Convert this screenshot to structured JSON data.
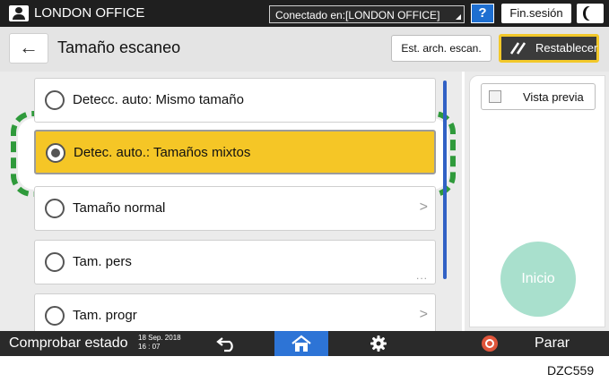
{
  "topbar": {
    "office_name": "LONDON OFFICE",
    "connection": "Conectado en:[LONDON OFFICE]",
    "help_label": "?",
    "logout_label": "Fin.sesión"
  },
  "header": {
    "back_symbol": "←",
    "title": "Tamaño escaneo",
    "scan_settings_label": "Est. arch. escan.",
    "reset_label": "Restablecer"
  },
  "options": [
    {
      "label": "Detecc. auto: Mismo tamaño",
      "selected": false,
      "trailing": ""
    },
    {
      "label": "Detec. auto.: Tamaños mixtos",
      "selected": true,
      "trailing": ""
    },
    {
      "label": "Tamaño normal",
      "selected": false,
      "trailing": "chevron"
    },
    {
      "label": "Tam. pers",
      "selected": false,
      "trailing": "dots"
    },
    {
      "label": "Tam. progr",
      "selected": false,
      "trailing": "chevron"
    }
  ],
  "right_panel": {
    "preview_label": "Vista previa",
    "start_label": "Inicio"
  },
  "bottombar": {
    "status_label": "Comprobar estado",
    "date": "18 Sep. 2018",
    "time": "16 : 07",
    "stop_label": "Parar"
  },
  "figure_code": "DZC559",
  "colors": {
    "selected_fill": "#f5c626",
    "highlight_dash": "#2f9a3b",
    "home_blue": "#2d74d6",
    "start_button": "#a9e0cd",
    "reset_border": "#f2c82a"
  }
}
